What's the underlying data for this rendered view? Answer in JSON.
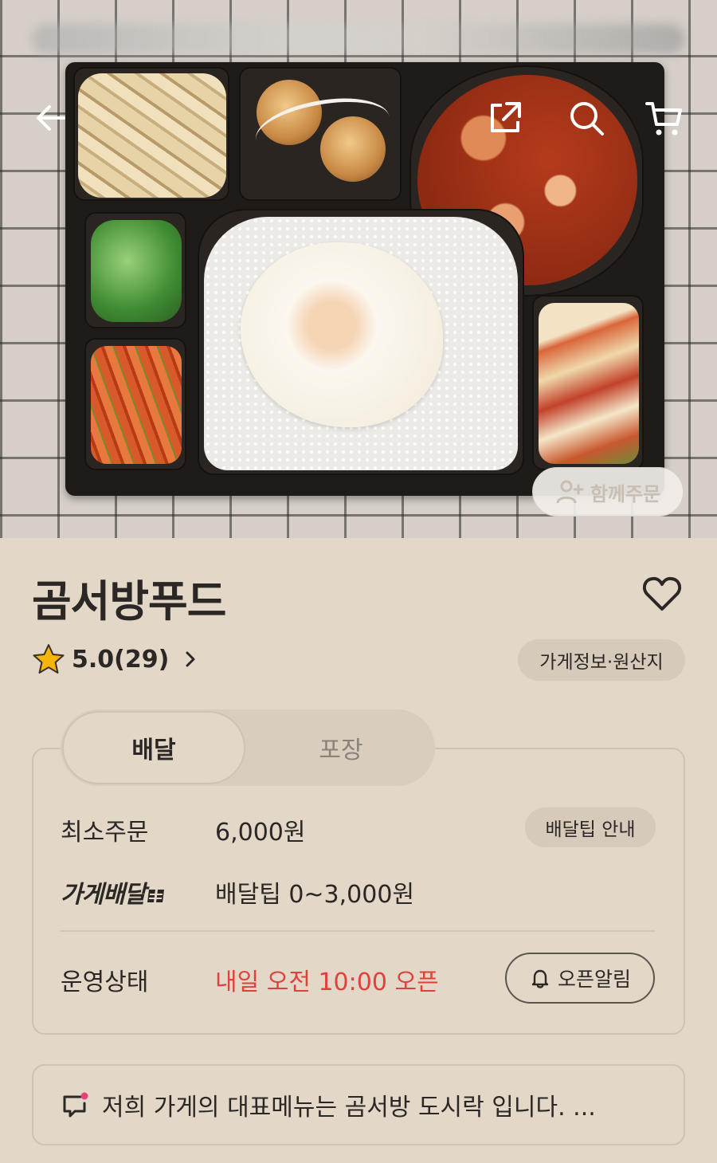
{
  "header": {
    "back_icon": "arrow-left-icon",
    "share_icon": "share-icon",
    "search_icon": "search-icon",
    "cart_icon": "cart-icon",
    "together_order_label": "함께주문"
  },
  "store": {
    "name": "곰서방푸드",
    "rating": "5.0(29)",
    "info_label": "가게정보·원산지",
    "favorite_icon": "heart-outline-icon"
  },
  "tabs": [
    {
      "label": "배달",
      "selected": true
    },
    {
      "label": "포장",
      "selected": false
    }
  ],
  "delivery": {
    "min_order_label": "최소주문",
    "min_order_value": "6,000원",
    "tip_info_label": "배달팁 안내",
    "store_delivery_label": "가게배달",
    "store_delivery_value": "배달팁 0~3,000원",
    "status_label": "운영상태",
    "status_value": "내일 오전 10:00 오픈",
    "open_alarm_label": "오픈알림"
  },
  "notice": {
    "text": "저희 가게의 대표메뉴는 곰서방 도시락 입니다. ..."
  },
  "colors": {
    "background": "#e3d7c8",
    "status_red": "#e0413a",
    "star_yellow": "#f5b50a",
    "notice_dot": "#e8417a"
  }
}
